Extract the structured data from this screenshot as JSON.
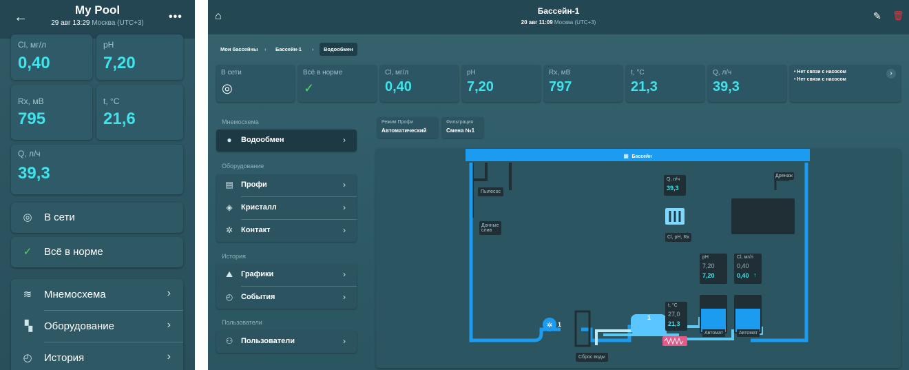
{
  "phone": {
    "title": "My Pool",
    "subtitle_date": "29 авг 13:29",
    "subtitle_tz": "Москва (UTC+3)",
    "metrics": [
      {
        "label": "Cl, мг/л",
        "value": "0,40"
      },
      {
        "label": "pH",
        "value": "7,20"
      },
      {
        "label": "Rx, мВ",
        "value": "795"
      },
      {
        "label": "t, °C",
        "value": "21,6"
      },
      {
        "label": "Q, л/ч",
        "value": "39,3"
      }
    ],
    "status_online": "В сети",
    "status_ok": "Всё в норме",
    "nav": [
      "Мнемосхема",
      "Оборудование",
      "История"
    ]
  },
  "desktop": {
    "title": "Бассейн-1",
    "subtitle_date": "20 авг 11:09",
    "subtitle_tz": "Москва (UTC+3)",
    "breadcrumb": [
      "Мои бассейны",
      "Бассейн-1",
      "Водообмен"
    ],
    "tiles": [
      {
        "label": "В сети",
        "value": ""
      },
      {
        "label": "Всё в норме",
        "value": ""
      },
      {
        "label": "Cl, мг/л",
        "value": "0,40"
      },
      {
        "label": "pH",
        "value": "7,20"
      },
      {
        "label": "Rx, мВ",
        "value": "797"
      },
      {
        "label": "t, °C",
        "value": "21,3"
      },
      {
        "label": "Q, л/ч",
        "value": "39,3"
      }
    ],
    "alerts": [
      "• Нет связи с насосом",
      "• Нет связи с насосом"
    ],
    "sections": {
      "mnemo": "Мнемосхема",
      "equipment": "Оборудование",
      "history": "История",
      "users": "Пользователи"
    },
    "menu": {
      "mnemo": [
        "Водообмен"
      ],
      "equipment": [
        "Профи",
        "Кристалл",
        "Контакт"
      ],
      "history": [
        "Графики",
        "События"
      ],
      "users": [
        "Пользователи"
      ]
    },
    "chips": [
      {
        "caption": "Режим Профи",
        "value": "Автоматический"
      },
      {
        "caption": "Фильтрация",
        "value": "Смена №1"
      }
    ],
    "diagram": {
      "pool_label": "Бассейн",
      "vacuum": "Пылесос",
      "bottom_drain": "Донные слив",
      "drainage": "Дренаж",
      "flow_label": "Q, л/ч",
      "flow_value": "39,3",
      "sensor_label": "Cl, pH, Rx",
      "ph_label": "pH",
      "ph_set": "7,20",
      "ph_value": "7,20",
      "cl_label": "Cl, мг/л",
      "cl_set": "0,40",
      "cl_value": "0,40",
      "cl_arrow": "↑",
      "temp_label": "t, °C",
      "temp_set": "27,0",
      "temp_value": "21,3",
      "pump_num": "1",
      "filter_num": "1",
      "waste": "Сброс воды",
      "auto1": "Автомат",
      "auto2": "Автомат"
    }
  },
  "colors": {
    "accent": "#3fe3ea",
    "pool_blue": "#1b9cf0",
    "heater": "#e05a8a",
    "delete": "#e8323c"
  }
}
